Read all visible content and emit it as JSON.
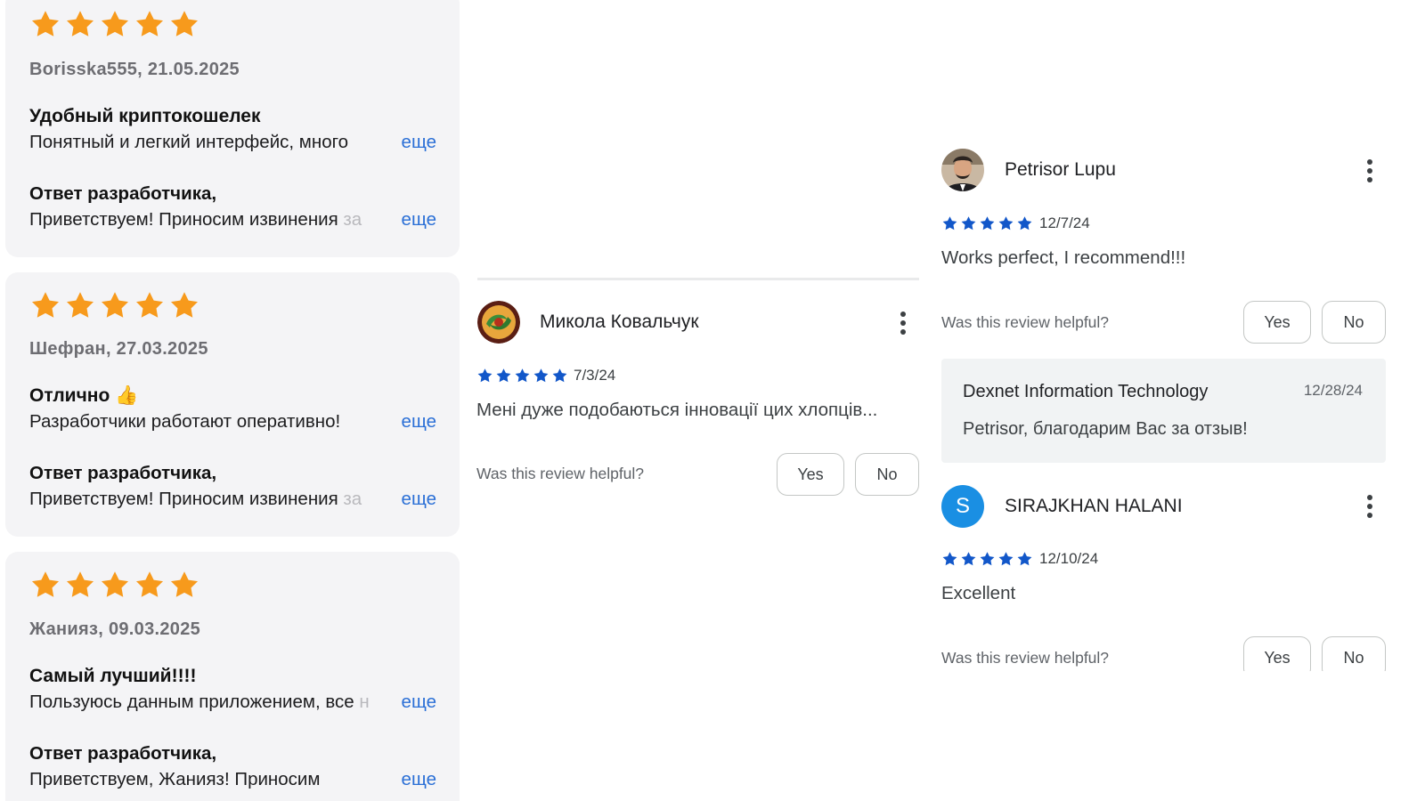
{
  "colors": {
    "app_store_star": "#f79a1c",
    "play_star": "#1257c9",
    "link": "#2a6fd6",
    "card_bg": "#f4f4f6",
    "letter_avatar": "#1a8fe3"
  },
  "app_store_reviews": [
    {
      "rating": 5,
      "author_date": "Borisska555, 21.05.2025",
      "title": "Удобный криптокошелек",
      "body": "Понятный и легкий интерфейс, много",
      "body_fade": "",
      "more": "еще",
      "reply_label": "Ответ разработчика,",
      "reply_text": "Приветствуем! Приносим извинения ",
      "reply_fade": "за",
      "reply_more": "еще"
    },
    {
      "rating": 5,
      "author_date": "Шефран, 27.03.2025",
      "title": "Отлично 👍",
      "body": "Разработчики работают оперативно!",
      "body_fade": "",
      "more": "еще",
      "reply_label": "Ответ разработчика,",
      "reply_text": "Приветствуем! Приносим извинения ",
      "reply_fade": "за",
      "reply_more": "еще"
    },
    {
      "rating": 5,
      "author_date": "Жанияз, 09.03.2025",
      "title": "Самый лучший!!!!",
      "body": "Пользуюсь данным приложением, все ",
      "body_fade": "н",
      "more": "еще",
      "reply_label": "Ответ разработчика,",
      "reply_text": "Приветствуем, Жанияз! Приносим",
      "reply_fade": "",
      "reply_more": "еще"
    }
  ],
  "play_reviews": [
    {
      "author": "Микола Ковальчук",
      "avatar_icon": "profile-photo",
      "rating": 5,
      "date": "7/3/24",
      "text": "Мені дуже подобаються інновації цих хлопців...",
      "helpful_prompt": "Was this review helpful?",
      "yes": "Yes",
      "no": "No"
    },
    {
      "author": "Petrisor Lupu",
      "avatar_icon": "profile-photo",
      "rating": 5,
      "date": "12/7/24",
      "text": "Works perfect, I recommend!!!",
      "helpful_prompt": "Was this review helpful?",
      "yes": "Yes",
      "no": "No",
      "developer_reply": {
        "name": "Dexnet Information Technology",
        "date": "12/28/24",
        "text": "Petrisor, благодарим Вас за отзыв!"
      }
    },
    {
      "author": "SIRAJKHAN HALANI",
      "avatar_letter": "S",
      "rating": 5,
      "date": "12/10/24",
      "text": "Excellent",
      "helpful_prompt": "Was this review helpful?",
      "yes": "Yes",
      "no": "No"
    }
  ]
}
